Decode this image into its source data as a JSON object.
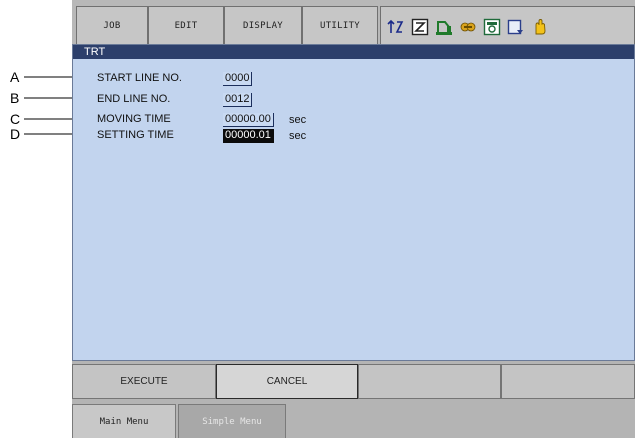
{
  "top_menu": {
    "tabs": [
      "JOB",
      "EDIT",
      "DISPLAY",
      "UTILITY"
    ],
    "status_icons": [
      "coordinate-icon",
      "cycle-step-icon",
      "robot-select-icon",
      "security-icon",
      "teach-mode-icon",
      "storage-icon",
      "servo-hand-icon"
    ]
  },
  "panel": {
    "title": "TRT",
    "fields": [
      {
        "label": "START LINE NO.",
        "value": "0000",
        "unit": ""
      },
      {
        "label": "END LINE NO.",
        "value": "0012",
        "unit": ""
      },
      {
        "label": "MOVING TIME",
        "value": "00000.00",
        "unit": "sec"
      },
      {
        "label": "SETTING TIME",
        "value": "00000.01",
        "unit": "sec"
      }
    ]
  },
  "function_buttons": {
    "execute": "EXECUTE",
    "cancel": "CANCEL",
    "empty1": "",
    "empty2": ""
  },
  "bottom_menu": {
    "main_menu": "Main Menu",
    "simple_menu": "Simple Menu"
  },
  "callouts": [
    "A",
    "B",
    "C",
    "D"
  ]
}
